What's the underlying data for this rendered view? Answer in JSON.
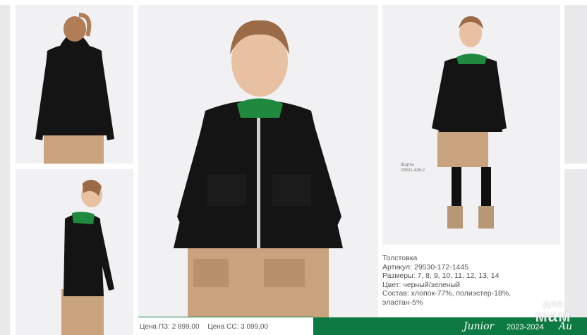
{
  "caption": {
    "label": "Шорты",
    "code": "29501-436-2"
  },
  "product": {
    "name": "Толстовка",
    "article": "Артикул: 29530-172-1445",
    "sizes": "Размеры: 7, 8, 9, 10, 11, 12, 13, 14",
    "color": "Цвет: черный/зеленый",
    "composition_1": "Состав: хлопок-77%, полиэстер-18%,",
    "composition_2": "эластан-5%"
  },
  "prices": {
    "pz": "Цена ПЗ: 2 899,00",
    "ss": "Цена СС: 3 099,00"
  },
  "footer": {
    "collection": "Junior",
    "season": "2023-2024",
    "brand_fragment": "Au"
  },
  "watermark": {
    "line1": "для",
    "line2": "мам"
  },
  "colors": {
    "accent_green": "#0e7a43",
    "jacket_black": "#141414",
    "shorts_beige": "#c9a37e",
    "background": "#f1f1f3"
  }
}
